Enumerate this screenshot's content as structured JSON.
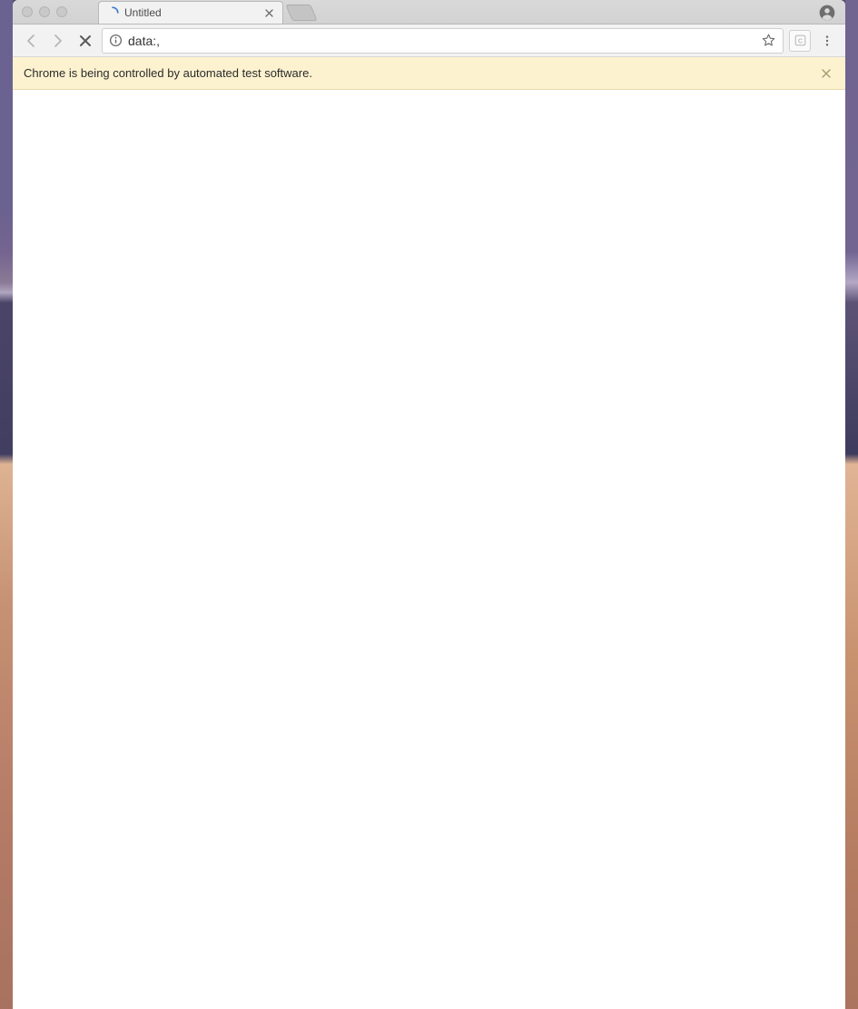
{
  "tabs": {
    "active": {
      "title": "Untitled"
    }
  },
  "address_bar": {
    "url": "data:,"
  },
  "info_bar": {
    "message": "Chrome is being controlled by automated test software."
  }
}
